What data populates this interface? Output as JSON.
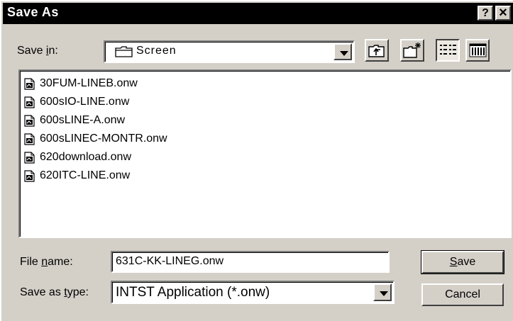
{
  "dialog": {
    "title": "Save As",
    "help_label": "?",
    "close_label": "×"
  },
  "save_in": {
    "label_pre": "Save ",
    "label_accel": "i",
    "label_post": "n:",
    "value": "Screen",
    "folder_icon": "folder-icon"
  },
  "toolbar": {
    "up_icon": "up-one-level-icon",
    "new_folder_icon": "new-folder-icon",
    "list_icon": "list-view-icon",
    "details_icon": "details-view-icon",
    "active_view": "list"
  },
  "files": [
    "30FUM-LINEB.onw",
    "600sIO-LINE.onw",
    "600sLINE-A.onw",
    "600sLINEC-MONTR.onw",
    "620download.onw",
    "620ITC-LINE.onw"
  ],
  "file_name": {
    "label_pre": "File ",
    "label_accel": "n",
    "label_post": "ame:",
    "value": "631C-KK-LINEG.onw"
  },
  "save_as_type": {
    "label_pre": "Save as ",
    "label_accel": "t",
    "label_post": "ype:",
    "value": "INTST Application (*.onw)"
  },
  "buttons": {
    "save_accel": "S",
    "save_rest": "ave",
    "cancel": "Cancel"
  }
}
